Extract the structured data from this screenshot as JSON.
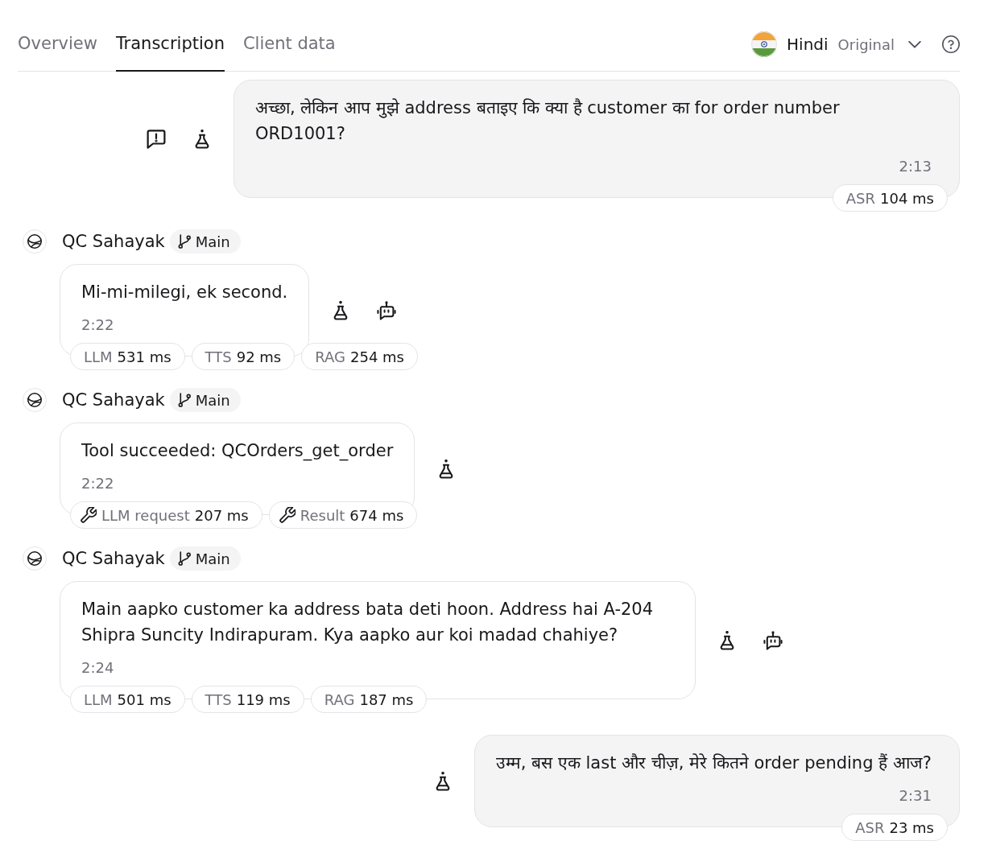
{
  "tabs": [
    {
      "label": "Overview",
      "selected": false
    },
    {
      "label": "Transcription",
      "selected": true
    },
    {
      "label": "Client data",
      "selected": false
    }
  ],
  "language": {
    "name": "Hindi",
    "mode": "Original"
  },
  "messages": [
    {
      "kind": "user",
      "text": "अच्छा, लेकिन आप मुझे address बताइए कि क्या है customer का for order number ORD1001?",
      "time": "2:13",
      "actions": [
        {
          "kind": "report"
        },
        {
          "kind": "eval"
        }
      ],
      "metrics": [
        {
          "kind": "timing",
          "label": "ASR",
          "value": "104 ms"
        }
      ]
    },
    {
      "kind": "agent",
      "speaker": "QC Sahayak",
      "branch": "Main",
      "text": "Mi-mi-milegi, ek second.",
      "time": "2:22",
      "actions": [
        {
          "kind": "eval"
        },
        {
          "kind": "bot"
        }
      ],
      "metrics": [
        {
          "kind": "timing",
          "label": "LLM",
          "value": "531 ms"
        },
        {
          "kind": "timing",
          "label": "TTS",
          "value": "92 ms"
        },
        {
          "kind": "timing",
          "label": "RAG",
          "value": "254 ms"
        }
      ]
    },
    {
      "kind": "agent",
      "speaker": "QC Sahayak",
      "branch": "Main",
      "text": "Tool succeeded: QCOrders_get_order",
      "time": "2:22",
      "actions": [
        {
          "kind": "eval"
        }
      ],
      "metrics": [
        {
          "kind": "tool",
          "label": "LLM request",
          "value": "207 ms"
        },
        {
          "kind": "tool",
          "label": "Result",
          "value": "674 ms"
        }
      ]
    },
    {
      "kind": "agent",
      "speaker": "QC Sahayak",
      "branch": "Main",
      "text": "Main aapko customer ka address bata deti hoon. Address hai A-204 Shipra Suncity Indirapuram. Kya aapko aur koi madad chahiye?",
      "time": "2:24",
      "actions": [
        {
          "kind": "eval"
        },
        {
          "kind": "bot"
        }
      ],
      "metrics": [
        {
          "kind": "timing",
          "label": "LLM",
          "value": "501 ms"
        },
        {
          "kind": "timing",
          "label": "TTS",
          "value": "119 ms"
        },
        {
          "kind": "timing",
          "label": "RAG",
          "value": "187 ms"
        }
      ]
    },
    {
      "kind": "user",
      "text": "उम्म, बस एक last और चीज़, मेरे कितने order pending हैं आज?",
      "time": "2:31",
      "actions": [
        {
          "kind": "eval"
        }
      ],
      "metrics": [
        {
          "kind": "timing",
          "label": "ASR",
          "value": "23 ms"
        }
      ]
    }
  ]
}
